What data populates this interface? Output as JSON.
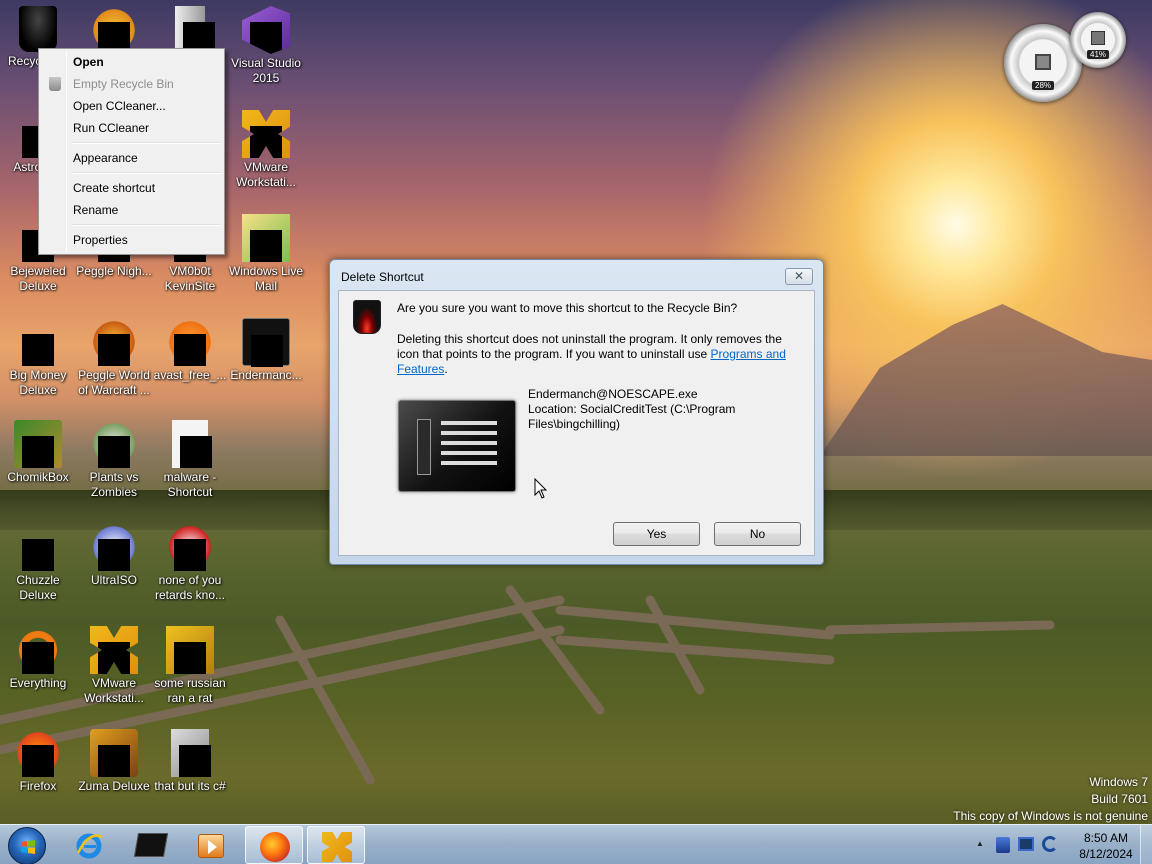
{
  "desktop": {
    "icons": [
      {
        "label": "Recycle Bin"
      },
      {
        "label": ""
      },
      {
        "label": ""
      },
      {
        "label": "Visual Studio 2015"
      },
      {
        "label": "AstroMenace Deluxe"
      },
      {
        "label": "VMware Workstati..."
      },
      {
        "label": "Bejeweled Deluxe"
      },
      {
        "label": "Peggle Nigh..."
      },
      {
        "label": "VM0b0t KevinSite"
      },
      {
        "label": "Windows Live Mail"
      },
      {
        "label": "Big Money Deluxe"
      },
      {
        "label": "Peggle World of Warcraft ..."
      },
      {
        "label": "avast_free_..."
      },
      {
        "label": "Endermanc..."
      },
      {
        "label": "ChomikBox"
      },
      {
        "label": "Plants vs Zombies"
      },
      {
        "label": "malware - Shortcut"
      },
      {
        "label": "Chuzzle Deluxe"
      },
      {
        "label": "UltraISO"
      },
      {
        "label": "none of you retards kno..."
      },
      {
        "label": "Everything"
      },
      {
        "label": "VMware Workstati..."
      },
      {
        "label": "some russian ran a rat"
      },
      {
        "label": "Firefox"
      },
      {
        "label": "Zuma Deluxe"
      },
      {
        "label": "that but its c#"
      }
    ],
    "recycle_label_visible": "Recyc",
    "astro_label_visible": "Astro Del",
    "trailing_icon_label": "Recyc"
  },
  "context_menu": {
    "items": [
      {
        "label": "Open"
      },
      {
        "label": "Empty Recycle Bin"
      },
      {
        "label": "Open CCleaner..."
      },
      {
        "label": "Run CCleaner"
      },
      {
        "label": "Appearance"
      },
      {
        "label": "Create shortcut"
      },
      {
        "label": "Rename"
      },
      {
        "label": "Properties"
      }
    ]
  },
  "dialog": {
    "title": "Delete Shortcut",
    "close_glyph": "✕",
    "question": "Are you sure you want to move this shortcut to the Recycle Bin?",
    "desc_prefix": "Deleting this shortcut does not uninstall the program. It only removes the icon that points to the program. If you want to uninstall use ",
    "desc_link": "Programs and Features",
    "desc_suffix": ".",
    "file_name": "Endermanch@NOESCAPE.exe",
    "file_location": "Location: SocialCreditTest (C:\\Program Files\\bingchilling)",
    "yes_label": "Yes",
    "no_label": "No"
  },
  "gadget": {
    "cpu_percent": "28%",
    "mem_percent": "41%"
  },
  "watermark": {
    "line1": "Windows 7",
    "line2": "Build 7601",
    "line3": "This copy of Windows is not genuine"
  },
  "taskbar": {
    "time": "8:50 AM",
    "date": "8/12/2024",
    "tray_chevron": "▲"
  },
  "colors": {
    "link": "#0066cc",
    "taskbar": "#a9c0dc"
  }
}
